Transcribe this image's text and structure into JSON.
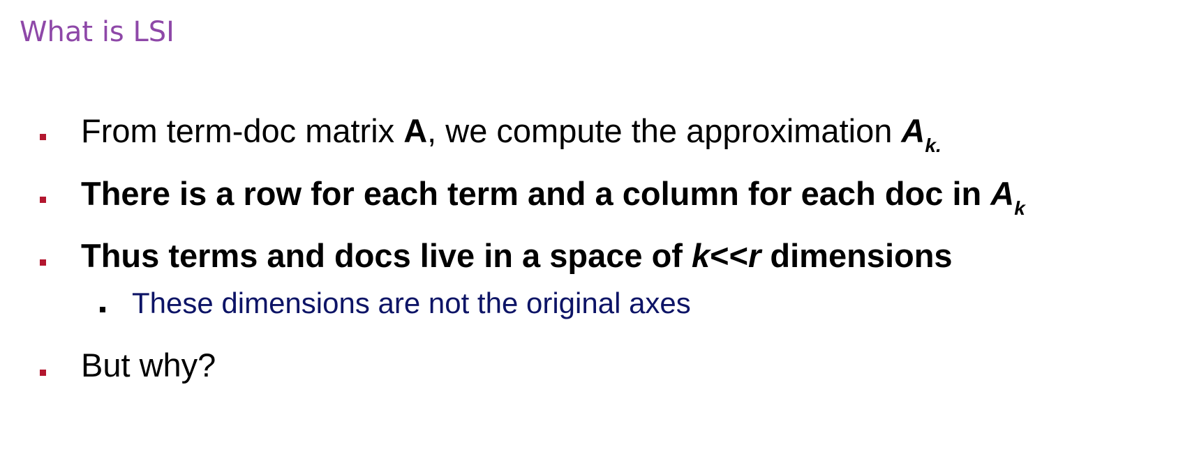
{
  "slide": {
    "title": "What is LSI"
  },
  "bullets": [
    {
      "part1": "From term-doc matrix ",
      "matrix": "A",
      "part2": ", we compute the approximation ",
      "approx": "A",
      "approx_sub": "k."
    },
    {
      "text": "There is a row for each term and a column for each doc in ",
      "approx": "A",
      "approx_sub": "k"
    },
    {
      "part1": "Thus terms and docs live in a space of ",
      "k": "k",
      "ll": "<<",
      "r": "r",
      "part2": " dimensions",
      "sub_bullet": "These dimensions are not the original axes"
    },
    {
      "text": "But why?"
    }
  ],
  "colors": {
    "title": "#8e48a8",
    "bullet_marker": "#b3172f",
    "sub_bullet_text": "#0d1466"
  }
}
